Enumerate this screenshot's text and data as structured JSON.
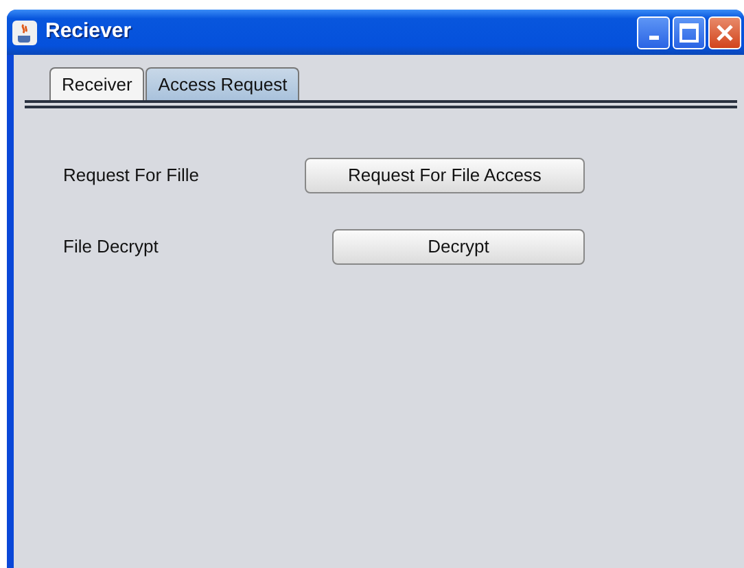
{
  "window": {
    "title": "Reciever"
  },
  "tabs": [
    {
      "label": "Receiver",
      "selected": false
    },
    {
      "label": "Access Request",
      "selected": true
    }
  ],
  "rows": [
    {
      "label": "Request For Fille",
      "button": "Request For File Access",
      "kind": "wide"
    },
    {
      "label": "File Decrypt",
      "button": "Decrypt",
      "kind": "narrow"
    }
  ]
}
